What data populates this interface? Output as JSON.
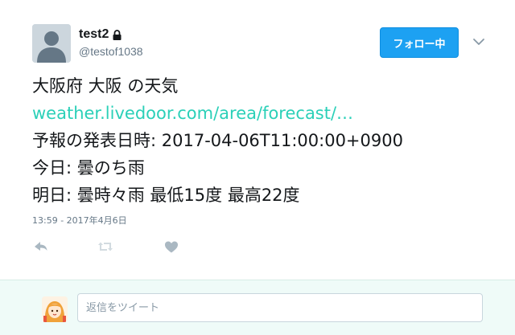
{
  "user": {
    "display_name": "test2",
    "handle": "@testof1038",
    "locked": true
  },
  "follow_button": {
    "label": "フォロー中"
  },
  "tweet": {
    "lines": [
      "大阪府 大阪 の天気",
      "weather.livedoor.com/area/forecast/…",
      "予報の発表日時: 2017-04-06T11:00:00+0900",
      "今日: 曇のち雨",
      "明日: 曇時々雨 最低15度 最高22度"
    ],
    "timestamp": "13:59 - 2017年4月6日"
  },
  "icons": {
    "lock": "lock-icon",
    "caret": "chevron-down-icon",
    "reply": "reply-icon",
    "retweet": "retweet-icon",
    "like": "heart-icon"
  },
  "colors": {
    "link": "#2bd0b8",
    "follow_button": "#1da1f2",
    "reply_bar": "#effbf8"
  },
  "reply_box": {
    "placeholder": "返信をツイート"
  }
}
